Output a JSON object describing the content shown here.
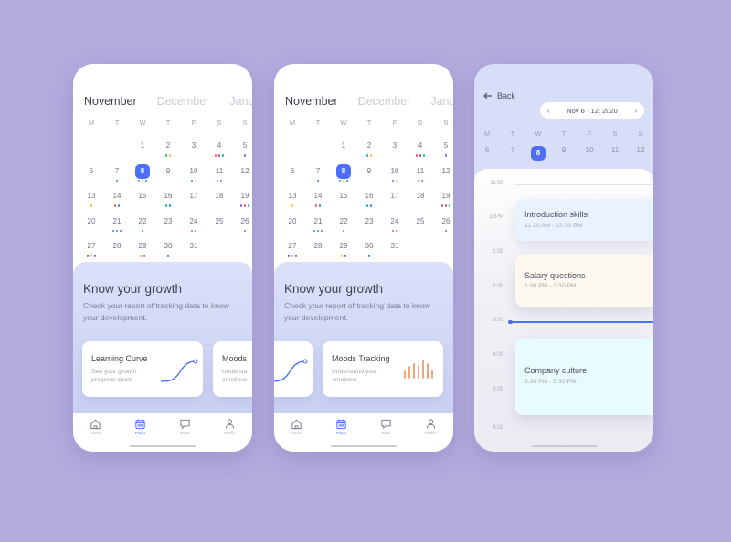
{
  "colors": {
    "background": "#b3acdd",
    "accent": "#4d6ef6",
    "chart_orange": "#f29b6b",
    "dot": {
      "teal": "#22b8b0",
      "yellow": "#f6c04e",
      "red": "#f0605a",
      "blue": "#2f8be0",
      "purple": "#8a62e8"
    }
  },
  "calendar": {
    "months": [
      "November",
      "December",
      "January"
    ],
    "active_month": "November",
    "weekdays": [
      "M",
      "T",
      "W",
      "T",
      "F",
      "S",
      "S"
    ],
    "selected_day": 8,
    "weeks": [
      [
        null,
        null,
        {
          "d": 1,
          "dots": []
        },
        {
          "d": 2,
          "dots": [
            "teal",
            "yellow"
          ]
        },
        {
          "d": 3,
          "dots": []
        },
        {
          "d": 4,
          "dots": [
            "red",
            "purple",
            "teal"
          ]
        },
        {
          "d": 5,
          "dots": [
            "purple"
          ]
        }
      ],
      [
        {
          "d": 6,
          "dots": []
        },
        {
          "d": 7,
          "dots": [
            "blue"
          ]
        },
        {
          "d": 8,
          "dots": [
            "teal",
            "yellow",
            "blue"
          ]
        },
        {
          "d": 9,
          "dots": []
        },
        {
          "d": 10,
          "dots": [
            "blue",
            "yellow"
          ]
        },
        {
          "d": 11,
          "dots": [
            "teal",
            "purple"
          ]
        },
        {
          "d": 12,
          "dots": []
        }
      ],
      [
        {
          "d": 13,
          "dots": [
            "yellow"
          ]
        },
        {
          "d": 14,
          "dots": [
            "red",
            "blue"
          ]
        },
        {
          "d": 15,
          "dots": []
        },
        {
          "d": 16,
          "dots": [
            "teal",
            "blue"
          ]
        },
        {
          "d": 17,
          "dots": []
        },
        {
          "d": 18,
          "dots": []
        },
        {
          "d": 19,
          "dots": [
            "purple",
            "red",
            "teal"
          ]
        }
      ],
      [
        {
          "d": 20,
          "dots": []
        },
        {
          "d": 21,
          "dots": [
            "blue",
            "teal",
            "purple"
          ]
        },
        {
          "d": 22,
          "dots": [
            "blue"
          ]
        },
        {
          "d": 23,
          "dots": []
        },
        {
          "d": 24,
          "dots": [
            "red",
            "purple"
          ]
        },
        {
          "d": 25,
          "dots": []
        },
        {
          "d": 26,
          "dots": [
            "purple"
          ]
        }
      ],
      [
        {
          "d": 27,
          "dots": [
            "blue",
            "yellow",
            "purple"
          ]
        },
        {
          "d": 28,
          "dots": []
        },
        {
          "d": 29,
          "dots": [
            "yellow",
            "purple"
          ]
        },
        {
          "d": 30,
          "dots": [
            "blue"
          ]
        },
        {
          "d": 31,
          "dots": []
        },
        null,
        null
      ]
    ]
  },
  "growth": {
    "title": "Know your growth",
    "subtitle": "Check your report of tracking data to know your development.",
    "cards": [
      {
        "title": "Learning Curve",
        "subtitle": "See your growth progress chart"
      },
      {
        "title": "Moods Tracking",
        "subtitle": "Understand your emotions"
      }
    ],
    "card2_short_title": "Moods",
    "card2_short_sub": "Understa emotions"
  },
  "nav": {
    "items": [
      {
        "label": "Home",
        "icon": "home-icon"
      },
      {
        "label": "Plans",
        "icon": "calendar-icon",
        "active": true
      },
      {
        "label": "Tutor",
        "icon": "chat-icon"
      },
      {
        "label": "Profile",
        "icon": "profile-icon"
      }
    ]
  },
  "schedule": {
    "back_label": "Back",
    "range_label": "Nov 6 - 12, 2020",
    "week_days": [
      "6",
      "7",
      "8",
      "9",
      "10",
      "11",
      "12"
    ],
    "selected_day": "8",
    "times": [
      "11:00",
      "12PM",
      "1:00",
      "2:00",
      "3:00",
      "4:00",
      "5:00",
      "6:00"
    ],
    "current_time": "3:00",
    "events": [
      {
        "title": "Introduction skills",
        "time": "11:30 AM - 12:30 PM",
        "color": "#e9f3ff"
      },
      {
        "title": "Salary questions",
        "time": "1:00 PM - 2:30 PM",
        "color": "#fdf9ee"
      },
      {
        "title": "Company culture",
        "time": "3:30 PM - 5:30 PM",
        "color": "#e9fcfd"
      }
    ]
  }
}
